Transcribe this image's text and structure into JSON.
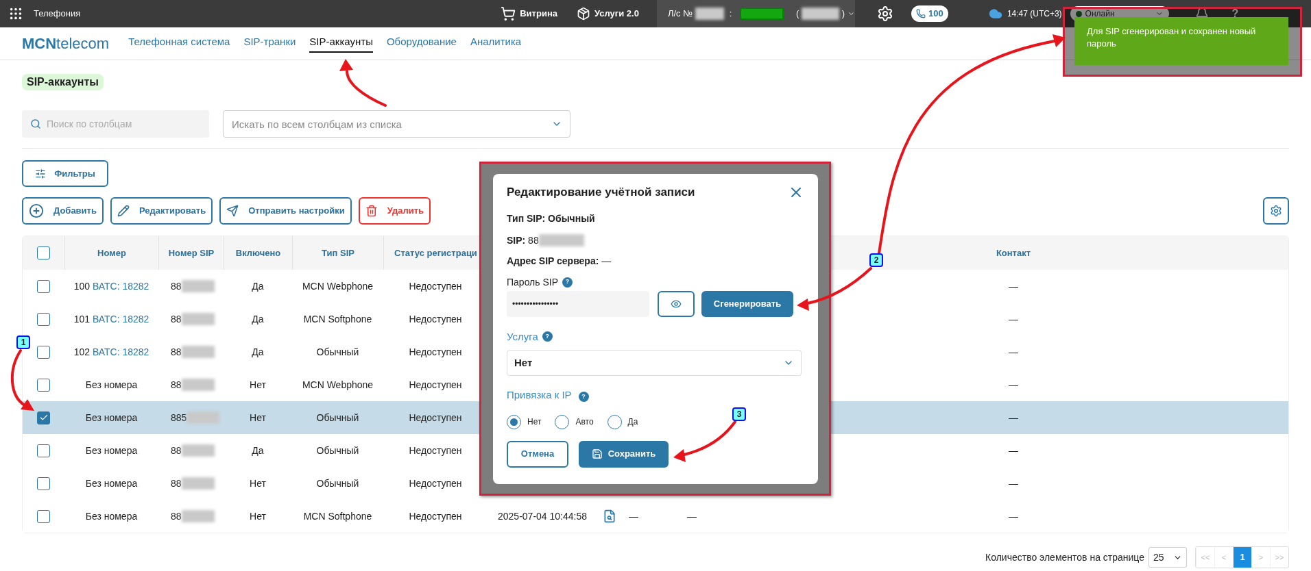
{
  "top_bar": {
    "app_title": "Телефония",
    "showcase": "Витрина",
    "services": "Услуги 2.0",
    "account_label": "Л/с №",
    "account_colon": ":",
    "paren_open": "(",
    "paren_close": ")",
    "calls": "100",
    "time": "14:47 (UTC+3)",
    "status": "Онлайн",
    "help": "?"
  },
  "nav": {
    "logo_bold": "MCN",
    "logo_rest": "telecom",
    "tabs": [
      {
        "label": "Телефонная система",
        "selected": false
      },
      {
        "label": "SIP-транки",
        "selected": false
      },
      {
        "label": "SIP-аккаунты",
        "selected": true
      },
      {
        "label": "Оборудование",
        "selected": false
      },
      {
        "label": "Аналитика",
        "selected": false
      }
    ]
  },
  "page_title": "SIP-аккаунты",
  "column_search": {
    "placeholder": "Поиск по столбцам"
  },
  "column_select": {
    "placeholder": "Искать по всем столбцам из списка"
  },
  "filters_button": "Фильтры",
  "actions": [
    {
      "kind": "add",
      "label": "Добавить"
    },
    {
      "kind": "edit",
      "label": "Редактировать"
    },
    {
      "kind": "send",
      "label": "Отправить настройки"
    },
    {
      "kind": "delete",
      "label": "Удалить"
    }
  ],
  "table": {
    "select_all": {
      "checked": false
    },
    "columns": [
      "Номер",
      "Номер SIP",
      "Включено",
      "Тип SIP",
      "Статус регистраци",
      "Контакт"
    ],
    "rows": [
      {
        "selected": false,
        "number": "100",
        "pbx_link": "ВАТС: 18282",
        "sip": "88",
        "enabled": "Да",
        "sip_type": "MCN Webphone",
        "status": "Недоступен",
        "contact": "—"
      },
      {
        "selected": false,
        "number": "101",
        "pbx_link": "ВАТС: 18282",
        "sip": "88",
        "enabled": "Да",
        "sip_type": "MCN Softphone",
        "status": "Недоступен",
        "contact": "—"
      },
      {
        "selected": false,
        "number": "102",
        "pbx_link": "ВАТС: 18282",
        "sip": "88",
        "enabled": "Да",
        "sip_type": "Обычный",
        "status": "Недоступен",
        "contact": "—"
      },
      {
        "selected": false,
        "number": "Без номера",
        "sip": "88",
        "enabled": "Нет",
        "sip_type": "MCN Webphone",
        "status": "Недоступен",
        "contact": "—"
      },
      {
        "selected": true,
        "number": "Без номера",
        "sip": "885",
        "enabled": "Нет",
        "sip_type": "Обычный",
        "status": "Недоступен",
        "contact": "—"
      },
      {
        "selected": false,
        "number": "Без номера",
        "sip": "88",
        "enabled": "Да",
        "sip_type": "Обычный",
        "status": "Недоступен",
        "contact": "—"
      },
      {
        "selected": false,
        "number": "Без номера",
        "sip": "88",
        "enabled": "Нет",
        "sip_type": "Обычный",
        "status": "Недоступен",
        "contact": "—"
      },
      {
        "selected": false,
        "number": "Без номера",
        "sip": "88",
        "enabled": "Нет",
        "sip_type": "MCN Softphone",
        "status": "Недоступен",
        "date": "2025-07-04 10:44:58",
        "column_8": "—",
        "column_9": "—",
        "contact": "—"
      }
    ]
  },
  "pagination": {
    "label": "Количество элементов на странице",
    "page_size": "25",
    "buttons": [
      {
        "label": "<<",
        "selected": false
      },
      {
        "label": "<",
        "selected": false
      },
      {
        "label": "1",
        "selected": true
      },
      {
        "label": ">",
        "selected": false
      },
      {
        "label": ">>",
        "selected": false
      }
    ]
  },
  "modal": {
    "title": "Редактирование учётной записи",
    "type_line": "Тип SIP: Обычный",
    "sip_line": "**SIP:** 88",
    "server_line": "**Адрес SIP сервера:** —",
    "password_label": "Пароль SIP",
    "password_value": "••••••••••••••••",
    "help_mark": "?",
    "generate_button": "Сгенерировать",
    "service_label": "Услуга",
    "service_value": "Нет",
    "ip_label": "Привязка к IP",
    "ip_options": [
      {
        "label": "Нет",
        "selected": true
      },
      {
        "label": "Авто",
        "selected": false
      },
      {
        "label": "Да",
        "selected": false
      }
    ],
    "cancel_button": "Отмена",
    "save_button": "Сохранить"
  },
  "toast": {
    "message": "Для SIP сгенерирован и сохранен новый пароль"
  },
  "annotations": [
    {
      "label": "1"
    },
    {
      "label": "2"
    },
    {
      "label": "3"
    }
  ]
}
